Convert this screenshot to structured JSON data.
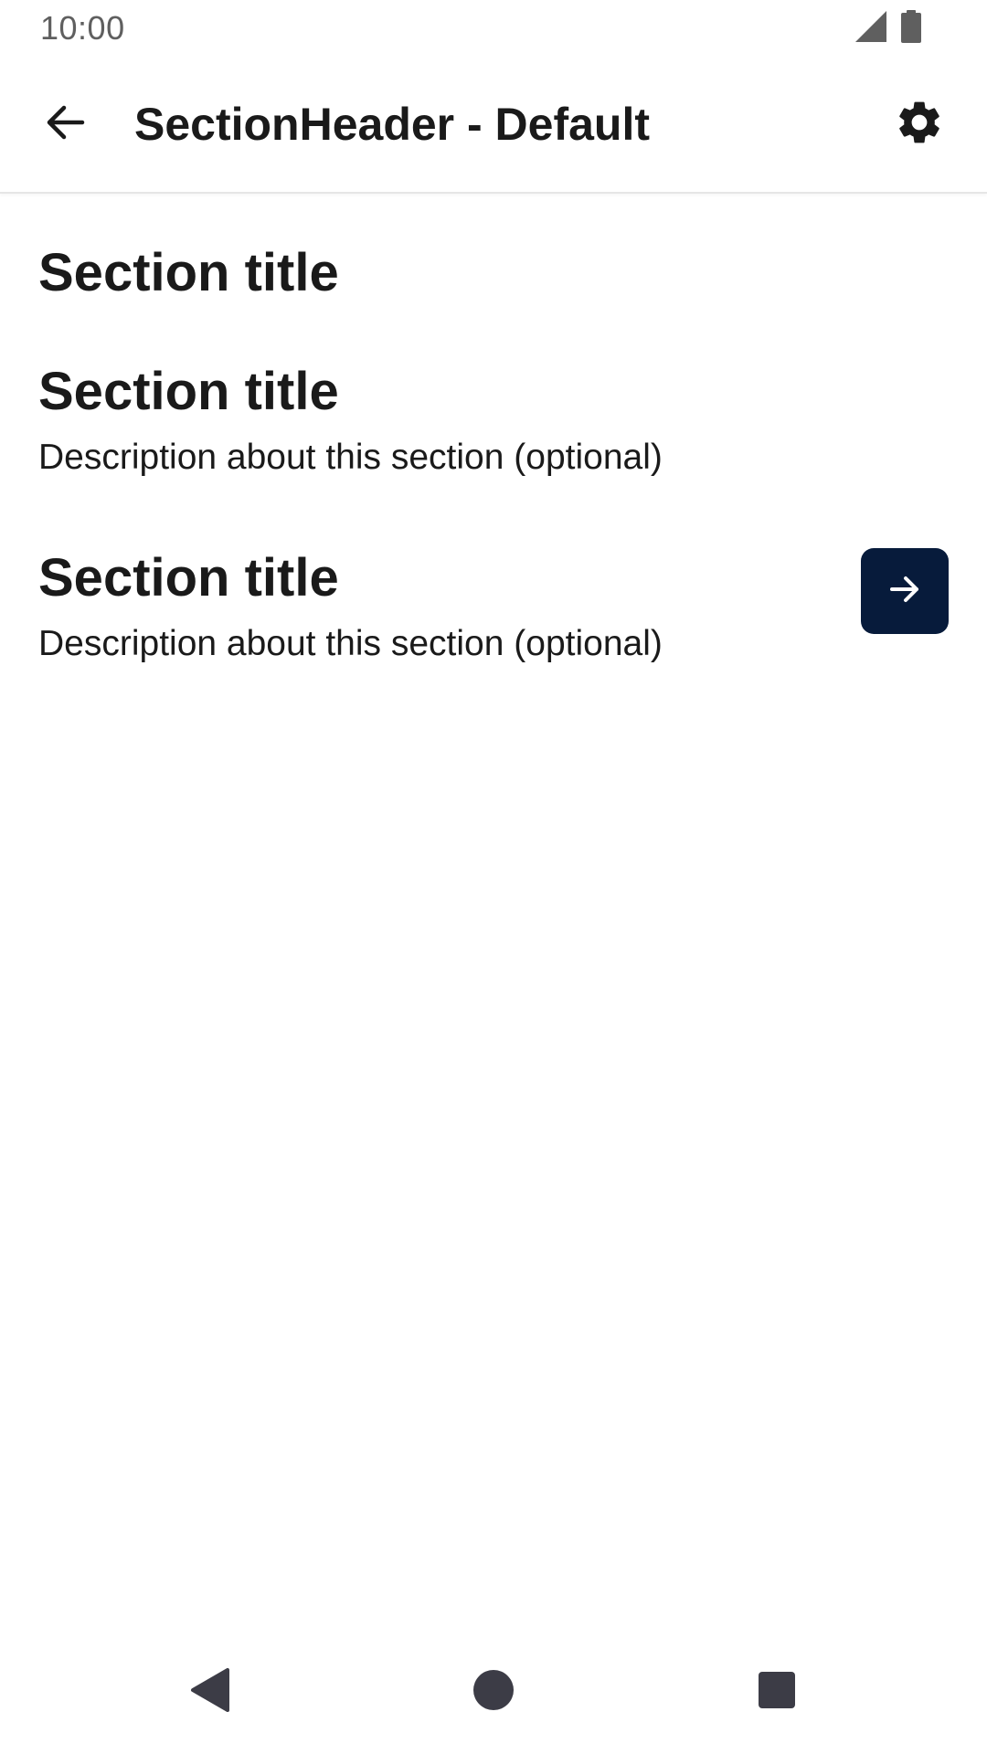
{
  "status_bar": {
    "time": "10:00",
    "icons": [
      "cellular-signal-icon",
      "battery-icon"
    ]
  },
  "app_bar": {
    "title": "SectionHeader - Default",
    "back_icon": "arrow-back-icon",
    "settings_icon": "gear-icon"
  },
  "sections": [
    {
      "title": "Section title"
    },
    {
      "title": "Section title",
      "description": "Description about this section (optional)"
    },
    {
      "title": "Section title",
      "description": "Description about this section (optional)",
      "action_icon": "arrow-forward-icon"
    }
  ],
  "nav_bar": {
    "icons": [
      "nav-back-icon",
      "nav-home-icon",
      "nav-recents-icon"
    ]
  },
  "colors": {
    "text": "#1a1a1a",
    "status_text": "#5f5f5f",
    "action_button": "#071b3b",
    "nav_icon": "#3c3c46"
  }
}
